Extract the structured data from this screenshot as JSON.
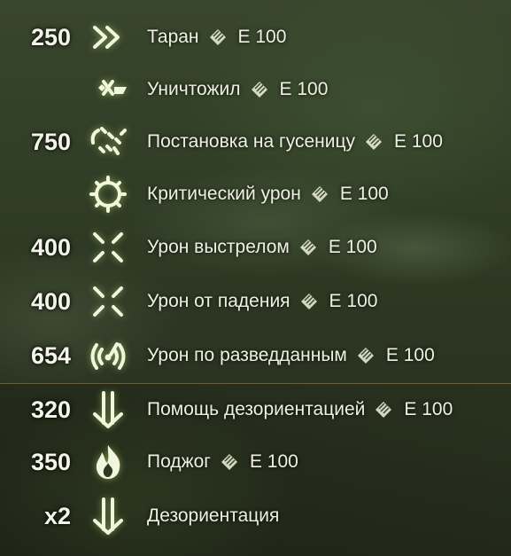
{
  "events": [
    {
      "points": "250",
      "icon": "ram-icon",
      "label": "Таран",
      "tank": "E 100"
    },
    {
      "points": "",
      "icon": "destroyed-icon",
      "label": "Уничтожил",
      "tank": "E 100"
    },
    {
      "points": "750",
      "icon": "track-icon",
      "label": "Постановка на гусеницу",
      "tank": "E 100"
    },
    {
      "points": "",
      "icon": "critical-damage-icon",
      "label": "Критический урон",
      "tank": "E 100"
    },
    {
      "points": "400",
      "icon": "shot-damage-icon",
      "label": "Урон выстрелом",
      "tank": "E 100"
    },
    {
      "points": "400",
      "icon": "fall-damage-icon",
      "label": "Урон от падения",
      "tank": "E 100"
    },
    {
      "points": "654",
      "icon": "spotting-damage-icon",
      "label": "Урон по разведданным",
      "tank": "E 100"
    },
    {
      "points": "320",
      "icon": "stun-assist-icon",
      "label": "Помощь дезориентацией",
      "tank": "E 100"
    },
    {
      "points": "350",
      "icon": "fire-icon",
      "label": "Поджог",
      "tank": "E 100"
    },
    {
      "points": "x2",
      "icon": "stun-icon",
      "label": "Дезориентация",
      "tank": ""
    }
  ],
  "colors": {
    "text": "#f3f5e8",
    "icon_glow": "#c3e87a",
    "accent_line": "#c8964f"
  }
}
